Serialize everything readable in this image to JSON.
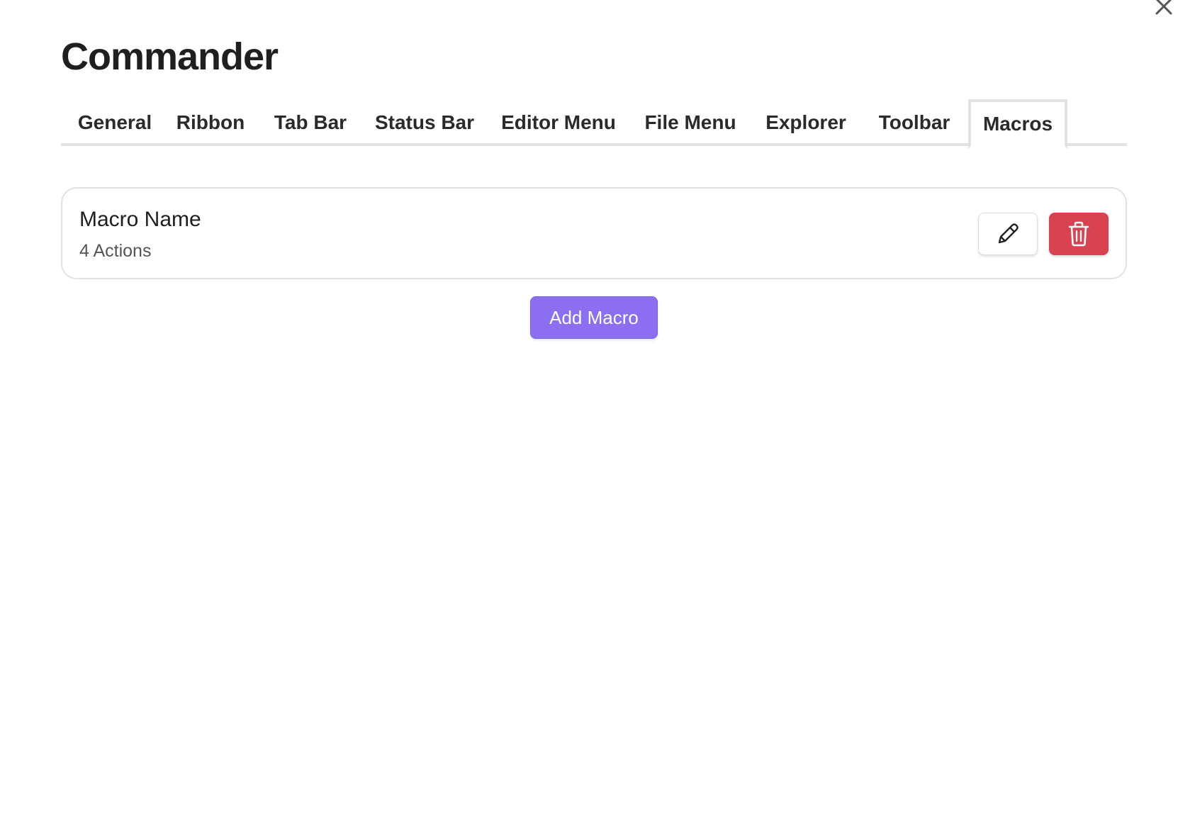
{
  "modal": {
    "title": "Commander",
    "close_icon": "close-icon"
  },
  "tabs": [
    {
      "label": "General",
      "active": false
    },
    {
      "label": "Ribbon",
      "active": false
    },
    {
      "label": "Tab Bar",
      "active": false
    },
    {
      "label": "Status Bar",
      "active": false
    },
    {
      "label": "Editor Menu",
      "active": false
    },
    {
      "label": "File Menu",
      "active": false
    },
    {
      "label": "Explorer",
      "active": false
    },
    {
      "label": "Toolbar",
      "active": false
    },
    {
      "label": "Macros",
      "active": true
    }
  ],
  "macros": [
    {
      "name": "Macro Name",
      "actions_label": "4 Actions",
      "edit_icon": "pencil-icon",
      "delete_icon": "trash-icon"
    }
  ],
  "add_button": {
    "label": "Add Macro"
  },
  "colors": {
    "delete": "#d9434f",
    "accent": "#8b6ff0",
    "border": "#e2e2e2"
  }
}
